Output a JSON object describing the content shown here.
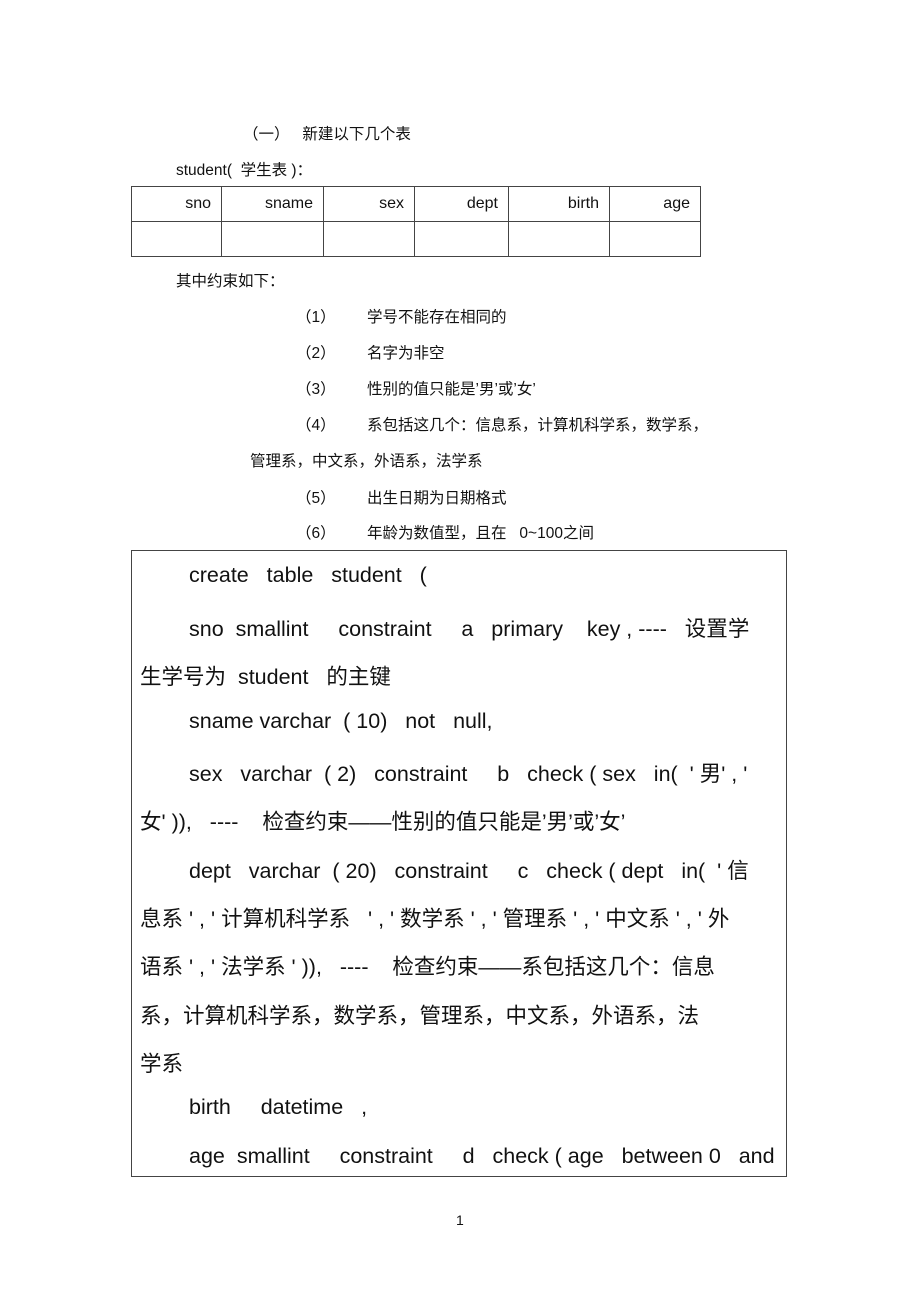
{
  "section_title": "（一）   新建以下几个表",
  "table_caption": "student(  学生表 )：",
  "student_table": {
    "headers": [
      "sno",
      "sname",
      "sex",
      "dept",
      "birth",
      "age"
    ],
    "rows": [
      [
        "",
        "",
        "",
        "",
        "",
        ""
      ]
    ]
  },
  "constraints": {
    "intro": "其中约束如下：",
    "items": [
      {
        "num": "（1）",
        "text": "学号不能存在相同的"
      },
      {
        "num": "（2）",
        "text": "名字为非空"
      },
      {
        "num": "（3）",
        "text": "性别的值只能是’男’或’女’"
      },
      {
        "num": "（4）",
        "text": "系包括这几个：信息系，计算机科学系，数学系，",
        "continuation": "管理系，中文系，外语系，法学系"
      },
      {
        "num": "（5）",
        "text": "出生日期为日期格式"
      },
      {
        "num": "（6）",
        "text": "年龄为数值型，且在   0~100之间"
      }
    ]
  },
  "code_box": {
    "lines": [
      "create   table   student   (",
      "sno  smallint     constraint     a   primary    key , ----   设置学",
      "生学号为  student   的主键",
      "sname varchar  ( 10)   not   null,",
      "sex   varchar  ( 2)   constraint     b   check ( sex   in(  ' 男' , '",
      "女' )),   ----    检查约束——性别的值只能是’男’或’女’",
      "dept   varchar  ( 20)   constraint     c   check ( dept   in(  ' 信",
      "息系 ' , ' 计算机科学系   ' , ' 数学系 ' , ' 管理系 ' , ' 中文系 ' , ' 外",
      "语系 ' , ' 法学系 ' )),   ----    检查约束——系包括这几个：信息",
      "系，计算机科学系，数学系，管理系，中文系，外语系，法",
      "学系",
      "birth     datetime   ,",
      "age  smallint     constraint     d   check ( age   between 0   and"
    ]
  },
  "page_number": "1"
}
